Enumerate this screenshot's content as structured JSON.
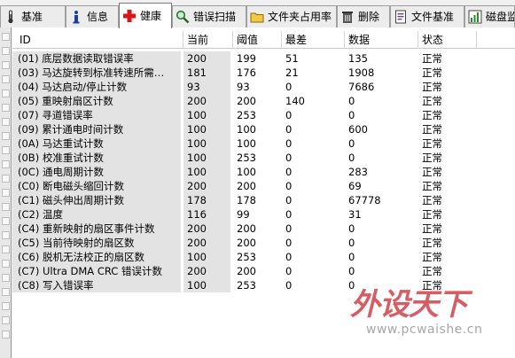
{
  "tabs": [
    {
      "label": "基准",
      "icon": "thermometer-icon"
    },
    {
      "label": "信息",
      "icon": "info-icon"
    },
    {
      "label": "健康",
      "icon": "red-cross-icon"
    },
    {
      "label": "错误扫描",
      "icon": "magnifier-icon"
    },
    {
      "label": "文件夹占用率",
      "icon": "folder-icon"
    },
    {
      "label": "删除",
      "icon": "trash-icon"
    },
    {
      "label": "文件基准",
      "icon": "document-icon"
    },
    {
      "label": "磁盘监",
      "icon": "chart-icon"
    }
  ],
  "active_tab": "健康",
  "columns": [
    "ID",
    "当前",
    "阈值",
    "最差",
    "数据",
    "状态"
  ],
  "rows": [
    {
      "id": "(01) 底层数据读取错误率",
      "cur": "200",
      "thr": "199",
      "worst": "51",
      "data": "135",
      "status": "正常"
    },
    {
      "id": "(03) 马达旋转到标准转速所需…",
      "cur": "181",
      "thr": "176",
      "worst": "21",
      "data": "1908",
      "status": "正常"
    },
    {
      "id": "(04) 马达启动/停止计数",
      "cur": "93",
      "thr": "93",
      "worst": "0",
      "data": "7686",
      "status": "正常"
    },
    {
      "id": "(05) 重映射扇区计数",
      "cur": "200",
      "thr": "200",
      "worst": "140",
      "data": "0",
      "status": "正常"
    },
    {
      "id": "(07) 寻道错误率",
      "cur": "100",
      "thr": "253",
      "worst": "0",
      "data": "0",
      "status": "正常"
    },
    {
      "id": "(09) 累计通电时间计数",
      "cur": "100",
      "thr": "100",
      "worst": "0",
      "data": "600",
      "status": "正常"
    },
    {
      "id": "(0A) 马达重试计数",
      "cur": "100",
      "thr": "100",
      "worst": "0",
      "data": "0",
      "status": "正常"
    },
    {
      "id": "(0B) 校准重试计数",
      "cur": "100",
      "thr": "253",
      "worst": "0",
      "data": "0",
      "status": "正常"
    },
    {
      "id": "(0C) 通电周期计数",
      "cur": "100",
      "thr": "100",
      "worst": "0",
      "data": "283",
      "status": "正常"
    },
    {
      "id": "(C0) 断电磁头缩回计数",
      "cur": "200",
      "thr": "200",
      "worst": "0",
      "data": "69",
      "status": "正常"
    },
    {
      "id": "(C1) 磁头伸出周期计数",
      "cur": "178",
      "thr": "178",
      "worst": "0",
      "data": "67778",
      "status": "正常"
    },
    {
      "id": "(C2) 温度",
      "cur": "116",
      "thr": "99",
      "worst": "0",
      "data": "31",
      "status": "正常"
    },
    {
      "id": "(C4) 重新映射的扇区事件计数",
      "cur": "200",
      "thr": "200",
      "worst": "0",
      "data": "0",
      "status": "正常"
    },
    {
      "id": "(C5) 当前待映射的扇区数",
      "cur": "200",
      "thr": "200",
      "worst": "0",
      "data": "0",
      "status": "正常"
    },
    {
      "id": "(C6) 脱机无法校正的扇区数",
      "cur": "100",
      "thr": "253",
      "worst": "0",
      "data": "0",
      "status": "正常"
    },
    {
      "id": "(C7) Ultra DMA CRC 错误计数",
      "cur": "200",
      "thr": "200",
      "worst": "0",
      "data": "0",
      "status": "正常"
    },
    {
      "id": "(C8) 写入错误率",
      "cur": "100",
      "thr": "253",
      "worst": "0",
      "data": "0",
      "status": "正常"
    }
  ],
  "watermark": {
    "logo": "外设天下",
    "url": "www.pcwaishe.cn"
  }
}
